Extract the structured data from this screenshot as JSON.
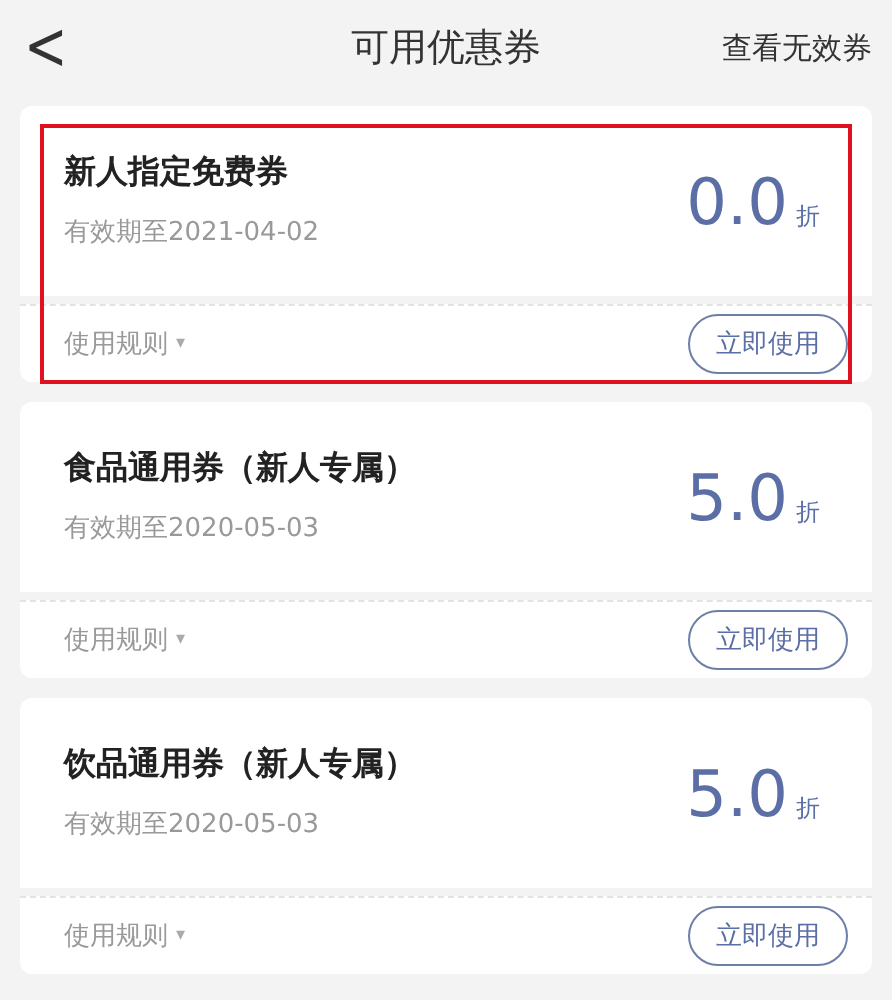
{
  "header": {
    "back": "<",
    "title": "可用优惠券",
    "action": "查看无效券"
  },
  "coupons": [
    {
      "name": "新人指定免费券",
      "validity": "有效期至2021-04-02",
      "value": "0.0",
      "unit": "折",
      "rules": "使用规则",
      "rules_caret": "▾",
      "use": "立即使用",
      "highlighted": true
    },
    {
      "name": "食品通用券（新人专属）",
      "validity": "有效期至2020-05-03",
      "value": "5.0",
      "unit": "折",
      "rules": "使用规则",
      "rules_caret": "▾",
      "use": "立即使用",
      "highlighted": false
    },
    {
      "name": "饮品通用券（新人专属）",
      "validity": "有效期至2020-05-03",
      "value": "5.0",
      "unit": "折",
      "rules": "使用规则",
      "rules_caret": "▾",
      "use": "立即使用",
      "highlighted": false
    }
  ]
}
